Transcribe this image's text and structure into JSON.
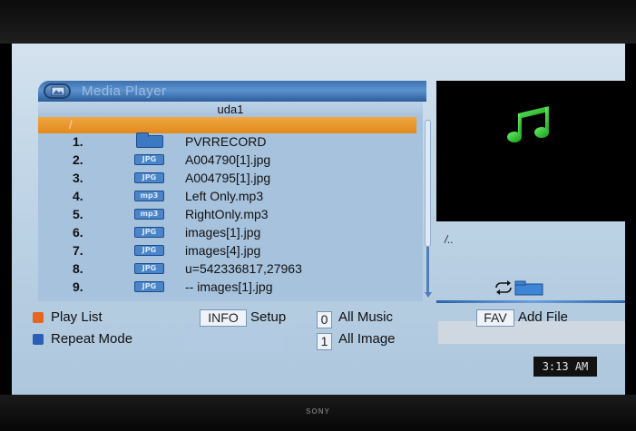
{
  "app": {
    "title": "Media Player",
    "device": "uda1",
    "current_path": "/"
  },
  "files": [
    {
      "num": "1.",
      "type": "folder",
      "badge": "",
      "name": "PVRRECORD"
    },
    {
      "num": "2.",
      "type": "jpg",
      "badge": "JPG",
      "name": "A004790[1].jpg"
    },
    {
      "num": "3.",
      "type": "jpg",
      "badge": "JPG",
      "name": "A004795[1].jpg"
    },
    {
      "num": "4.",
      "type": "mp3",
      "badge": "mp3",
      "name": "Left Only.mp3"
    },
    {
      "num": "5.",
      "type": "mp3",
      "badge": "mp3",
      "name": "RightOnly.mp3"
    },
    {
      "num": "6.",
      "type": "jpg",
      "badge": "JPG",
      "name": "images[1].jpg"
    },
    {
      "num": "7.",
      "type": "jpg",
      "badge": "JPG",
      "name": "images[4].jpg"
    },
    {
      "num": "8.",
      "type": "jpg",
      "badge": "JPG",
      "name": "u=542336817,27963"
    },
    {
      "num": "9.",
      "type": "jpg",
      "badge": "JPG",
      "name": "-- images[1].jpg"
    }
  ],
  "preview": {
    "path": "/.."
  },
  "help": {
    "play_list": "Play List",
    "repeat_mode": "Repeat Mode",
    "info_key": "INFO",
    "setup": "Setup",
    "key_0": "0",
    "all_music": "All Music",
    "key_1": "1",
    "all_image": "All Image",
    "fav_key": "FAV",
    "add_file": "Add File"
  },
  "clock": "3:13 AM",
  "brand": "SONY",
  "colors": {
    "selection": "#e8961f",
    "header": "#3d70b0",
    "play_list_dot": "#e8641f",
    "repeat_dot": "#2a5fb8",
    "music_note": "#2ec62e"
  }
}
